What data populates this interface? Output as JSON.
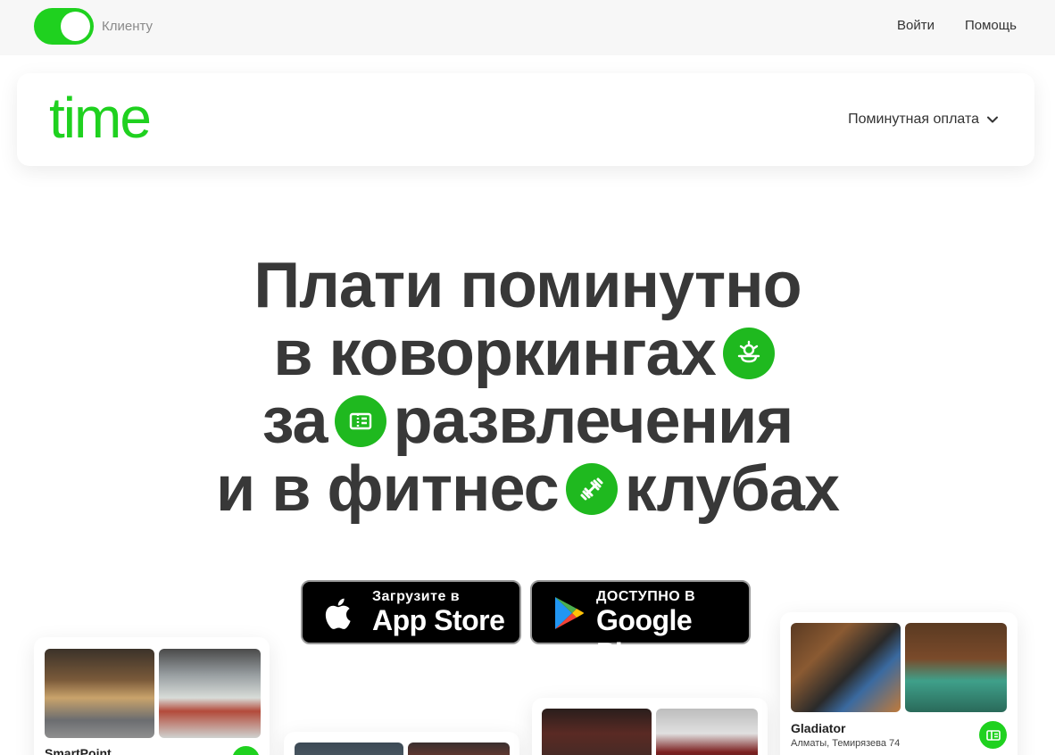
{
  "topbar": {
    "toggle_label": "Клиенту",
    "login": "Войти",
    "help": "Помощь"
  },
  "nav": {
    "logo": "time",
    "menu_label": "Поминутная оплата"
  },
  "hero": {
    "line1": "Плати поминутно",
    "line2": "в коворкингах",
    "line3a": "за",
    "line3b": "развлечения",
    "line4a": "и в фитнес",
    "line4b": "клубах"
  },
  "stores": {
    "appstore_small": "Загрузите в",
    "appstore_big": "App Store",
    "gplay_small": "ДОСТУПНО В",
    "gplay_big": "Google Play"
  },
  "cards": {
    "left": {
      "name": "SmartPoint"
    },
    "right": {
      "name": "Gladiator",
      "address": "Алматы, Темирязева 74"
    }
  },
  "colors": {
    "accent": "#1fd11f",
    "badge": "#1fb91f",
    "heading": "#383838"
  },
  "icons": [
    "coworking-icon",
    "ticket-icon",
    "dumbbell-icon",
    "apple-icon",
    "google-play-icon",
    "chevron-down-icon"
  ]
}
